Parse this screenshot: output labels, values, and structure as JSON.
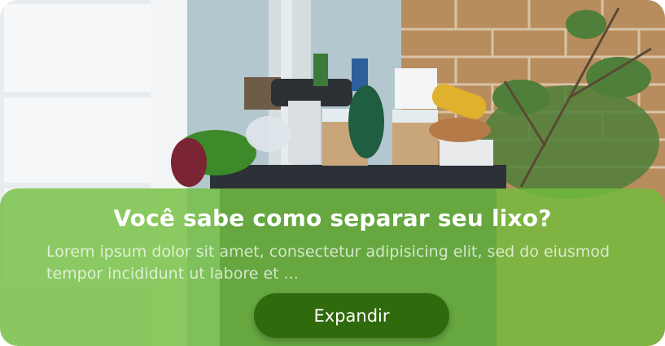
{
  "card": {
    "title": "Você sabe como separar seu lixo?",
    "description": "Lorem ipsum dolor sit amet, consectetur adipisicing elit, sed do eiusmod tempor incididunt ut labore et ...",
    "expand_label": "Expandir"
  },
  "colors": {
    "overlay": "#70be3c",
    "button": "#2f6a0c",
    "text": "#ffffff"
  }
}
